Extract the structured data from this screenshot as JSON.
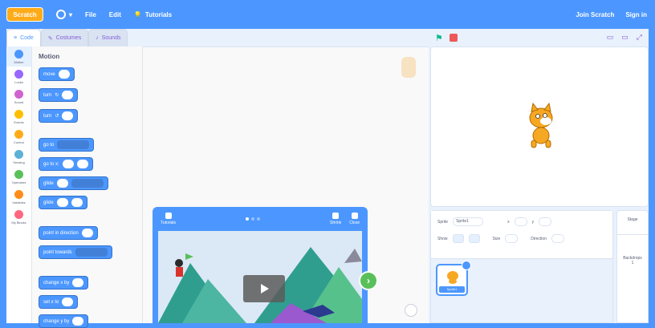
{
  "menubar": {
    "logo": "Scratch",
    "file": "File",
    "edit": "Edit",
    "tutorials": "Tutorials",
    "join": "Join Scratch",
    "signin": "Sign in"
  },
  "tabs": [
    {
      "label": "Code"
    },
    {
      "label": "Costumes"
    },
    {
      "label": "Sounds"
    }
  ],
  "categories": [
    {
      "label": "Motion",
      "color": "#4c97ff"
    },
    {
      "label": "Looks",
      "color": "#9966ff"
    },
    {
      "label": "Sound",
      "color": "#cf63cf"
    },
    {
      "label": "Events",
      "color": "#ffbf00"
    },
    {
      "label": "Control",
      "color": "#ffab19"
    },
    {
      "label": "Sensing",
      "color": "#5cb1d6"
    },
    {
      "label": "Operators",
      "color": "#59c059"
    },
    {
      "label": "Variables",
      "color": "#ff8c1a"
    },
    {
      "label": "My Blocks",
      "color": "#ff6680"
    }
  ],
  "palette": {
    "title": "Motion",
    "blocks": [
      "move",
      "turn",
      "turn",
      "go to",
      "go to x:",
      "glide",
      "glide",
      "point in direction",
      "point towards",
      "change x by",
      "set x to",
      "change y by"
    ]
  },
  "tutorial": {
    "tutorials_label": "Tutorials",
    "shrink_label": "Shrink",
    "close_label": "Close",
    "next": "›"
  },
  "stage": {
    "flag": "⚑"
  },
  "sprite_info": {
    "sprite_label": "Sprite",
    "sprite_name": "Sprite1",
    "show_label": "Show",
    "size_label": "Size",
    "direction_label": "Direction",
    "x_label": "x",
    "y_label": "y"
  },
  "sprite_tile": {
    "label": "Sprite1"
  },
  "stage_pane": {
    "title": "Stage",
    "backdrops": "Backdrops",
    "count": "1"
  }
}
